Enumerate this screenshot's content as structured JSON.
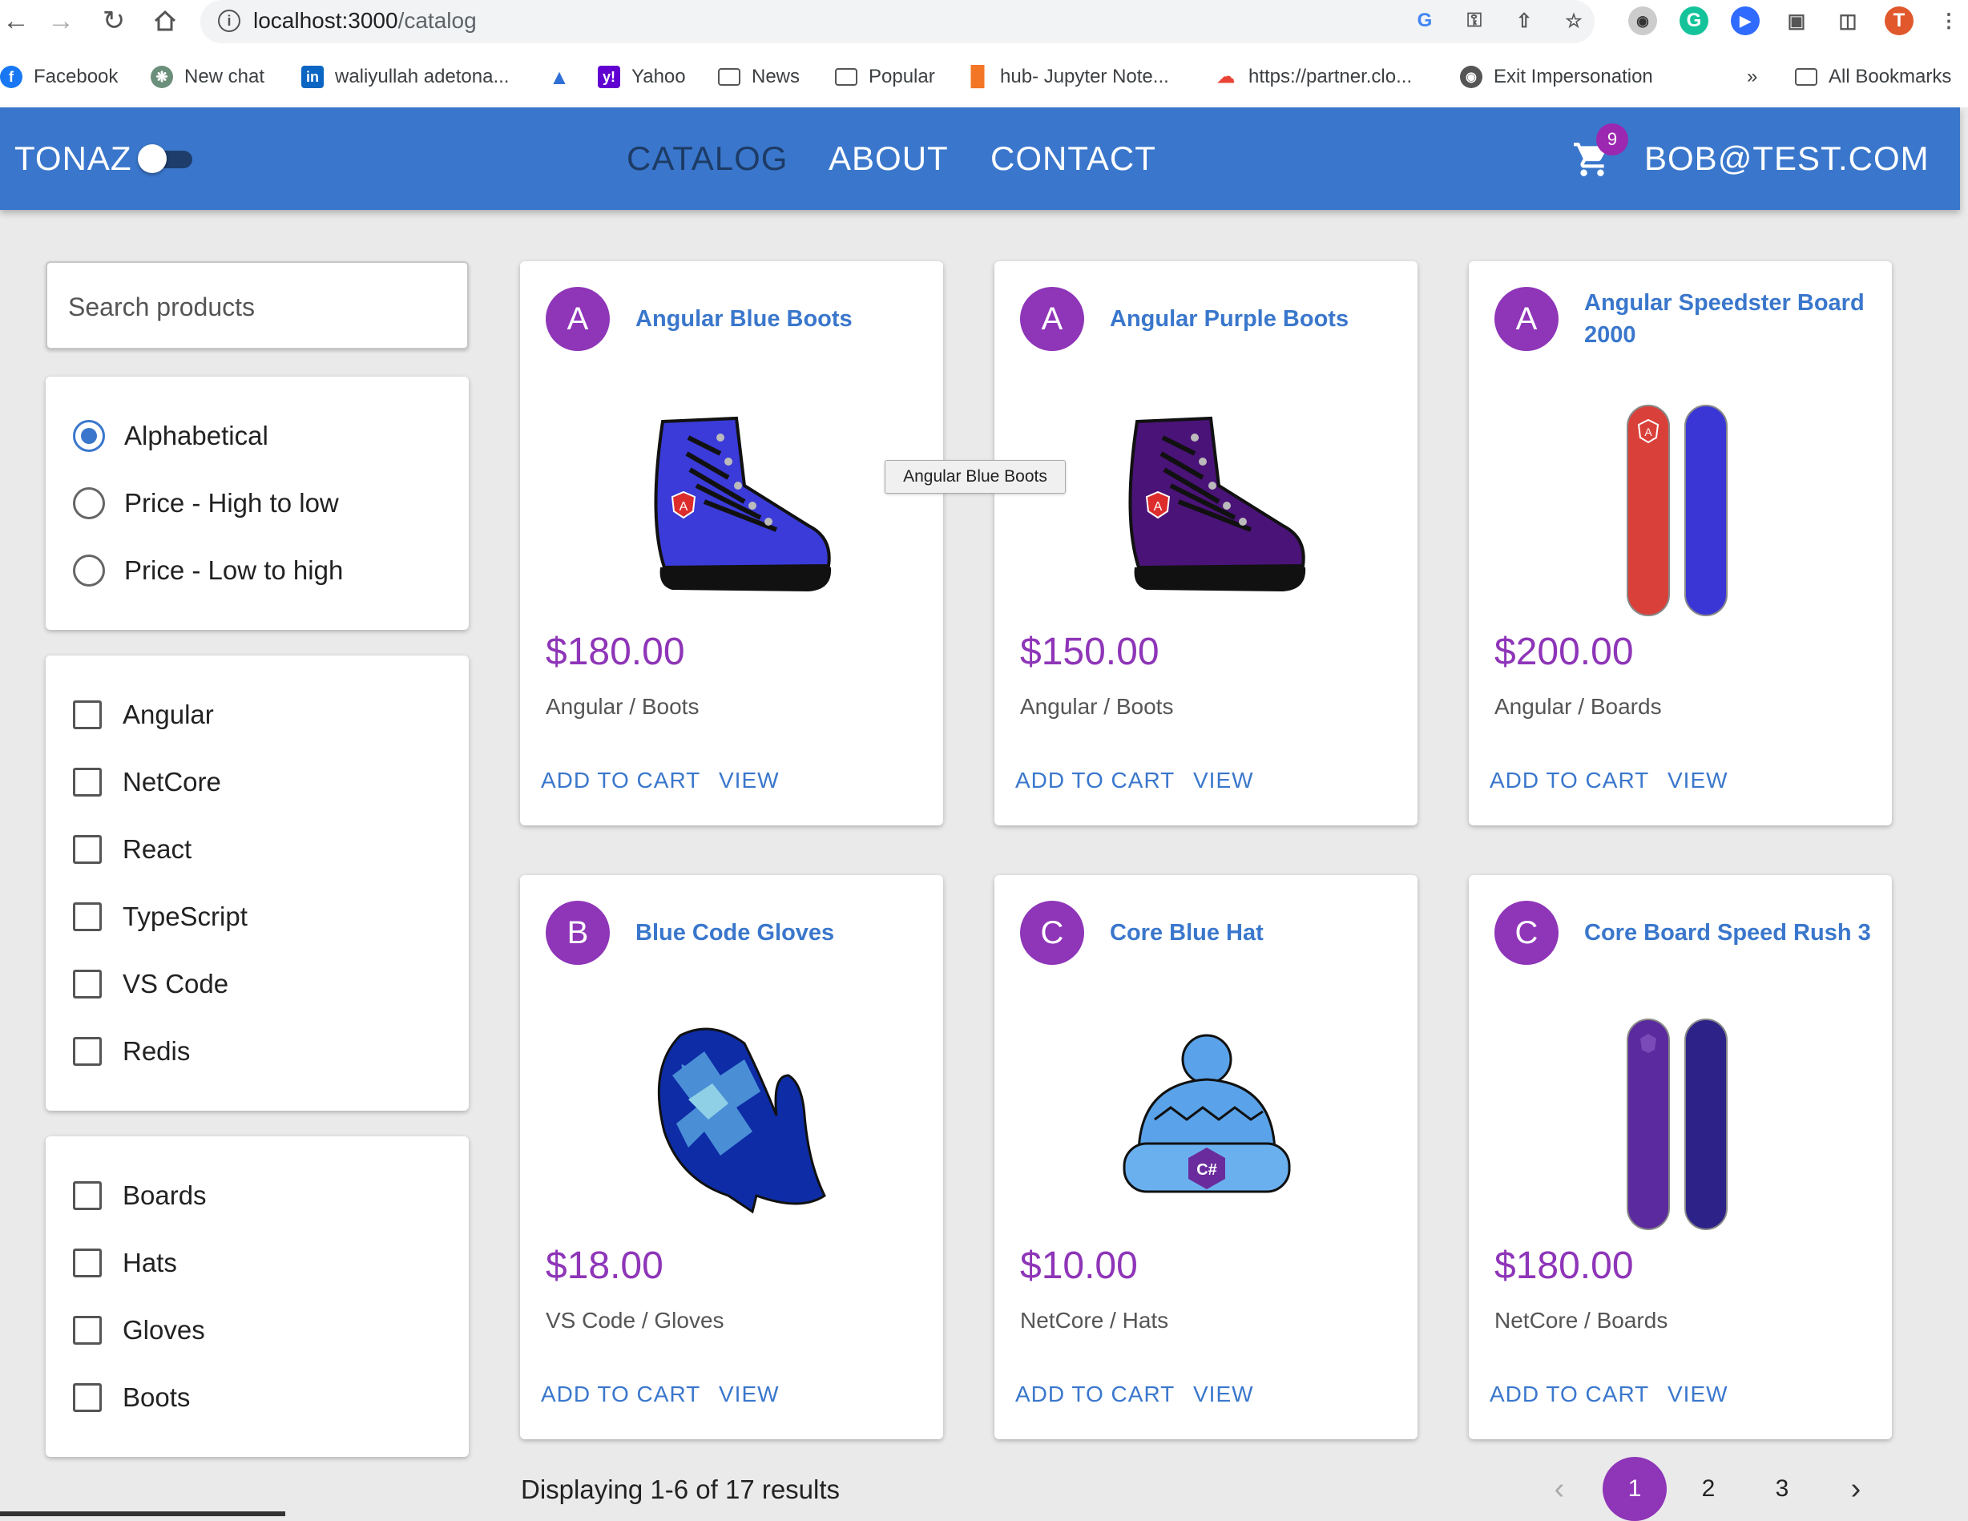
{
  "browser": {
    "url_host": "localhost:3000",
    "url_path": "/catalog",
    "profile_initial": "T",
    "bookmarks": [
      {
        "label": "Facebook"
      },
      {
        "label": "New chat"
      },
      {
        "label": "waliyullah adetona..."
      },
      {
        "label": ""
      },
      {
        "label": "Yahoo"
      },
      {
        "label": "News"
      },
      {
        "label": "Popular"
      },
      {
        "label": "hub- Jupyter Note..."
      },
      {
        "label": "https://partner.clo..."
      },
      {
        "label": "Exit Impersonation"
      }
    ],
    "more_bookmarks": "»",
    "all_bookmarks": "All Bookmarks"
  },
  "appbar": {
    "brand": "TONAZ",
    "nav": [
      "CATALOG",
      "ABOUT",
      "CONTACT"
    ],
    "cart_count": "9",
    "user": "BOB@TEST.COM",
    "colors": {
      "bar": "#3a77cc",
      "active_link": "#1d3b66",
      "badge": "#9c27b0"
    }
  },
  "filters": {
    "search_placeholder": "Search products",
    "sort_options": [
      "Alphabetical",
      "Price - High to low",
      "Price - Low to high"
    ],
    "sort_selected": "Alphabetical",
    "brands": [
      "Angular",
      "NetCore",
      "React",
      "TypeScript",
      "VS Code",
      "Redis"
    ],
    "types": [
      "Boards",
      "Hats",
      "Gloves",
      "Boots"
    ]
  },
  "products": [
    {
      "initial": "A",
      "name": "Angular Blue Boots",
      "price": "$180.00",
      "category": "Angular / Boots",
      "image": "boot-blue-icon"
    },
    {
      "initial": "A",
      "name": "Angular Purple Boots",
      "price": "$150.00",
      "category": "Angular / Boots",
      "image": "boot-purple-icon"
    },
    {
      "initial": "A",
      "name": "Angular Speedster Board 2000",
      "price": "$200.00",
      "category": "Angular / Boards",
      "image": "snowboard-red-blue-icon"
    },
    {
      "initial": "B",
      "name": "Blue Code Gloves",
      "price": "$18.00",
      "category": "VS Code / Gloves",
      "image": "mitten-blue-icon"
    },
    {
      "initial": "C",
      "name": "Core Blue Hat",
      "price": "$10.00",
      "category": "NetCore / Hats",
      "image": "beanie-blue-icon"
    },
    {
      "initial": "C",
      "name": "Core Board Speed Rush 3",
      "price": "$180.00",
      "category": "NetCore / Boards",
      "image": "snowboard-purple-icon"
    }
  ],
  "card_actions": {
    "add": "ADD TO CART",
    "view": "VIEW"
  },
  "tooltip": "Angular Blue Boots",
  "pagination": {
    "summary": "Displaying 1-6 of 17 results",
    "pages": [
      "1",
      "2",
      "3"
    ],
    "current": "1",
    "prev": "‹",
    "next": "›"
  },
  "accent_price": "#8e35b8"
}
